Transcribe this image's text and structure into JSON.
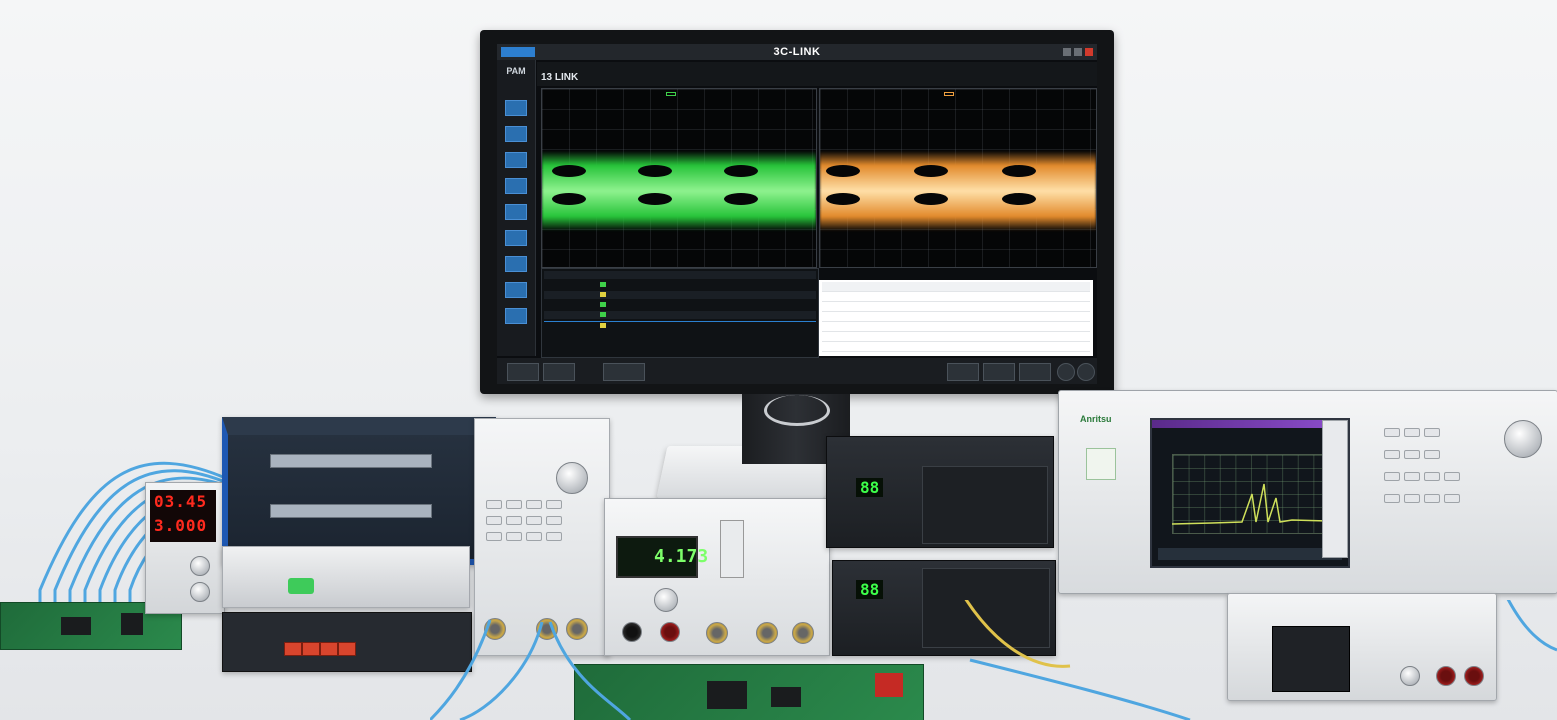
{
  "monitor": {
    "app_title": "3C-LINK",
    "sub_title": "13 LINK",
    "side_label": "PAM",
    "menu_items": [
      "",
      "",
      "",
      "",
      ""
    ]
  },
  "instruments": {
    "psu_display_1": "03.45",
    "psu_display_2": "3.000",
    "blue_box_brand": "",
    "sig_gen_brand": "",
    "counter_display": "4.173",
    "black_unit_1_digits": "88",
    "black_unit_2_digits": "88",
    "analyzer_brand": "Anritsu"
  },
  "colors": {
    "eye_left": "#3fd04a",
    "eye_right": "#f0a040",
    "cable": "#4fa6e0",
    "accent_blue": "#1e58b3"
  }
}
